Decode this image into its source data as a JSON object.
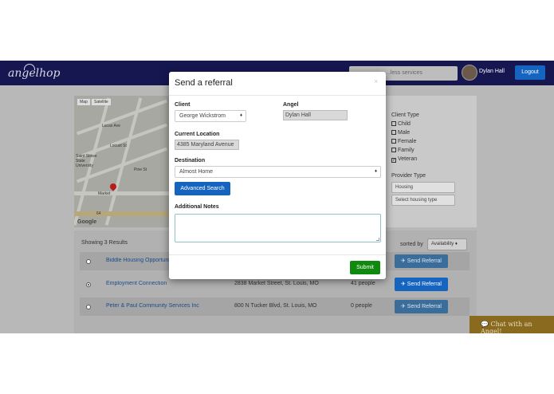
{
  "navbar": {
    "logo": "angelhop",
    "search_placeholder": "...less services",
    "username": "Dylan Hall",
    "logout_label": "Logout"
  },
  "map": {
    "tabs": [
      "Map",
      "Satellite"
    ],
    "labels": [
      "Lucas Ave",
      "Locust St",
      "Pine St",
      "Saint Stowe State University",
      "Market",
      "64"
    ],
    "google": "Google"
  },
  "filters": {
    "client_type_label": "Client Type",
    "client_types": [
      {
        "label": "Child",
        "checked": false
      },
      {
        "label": "Male",
        "checked": false
      },
      {
        "label": "Female",
        "checked": false
      },
      {
        "label": "Family",
        "checked": false
      },
      {
        "label": "Veteran",
        "checked": true
      }
    ],
    "provider_type_label": "Provider Type",
    "provider_type_value": "Housing",
    "housing_type_value": "Select housing type"
  },
  "results": {
    "showing": "Showing 3 Results",
    "sorted_by": "sorted by",
    "sort_value": "Availability",
    "rows": [
      {
        "name": "Biddle Housing Opportunities",
        "address": "",
        "people": "",
        "selected": false,
        "action": "Send Referral"
      },
      {
        "name": "Employment Connection",
        "address": "2838 Market Street, St. Louis, MO",
        "people": "41 people",
        "selected": true,
        "action": "Send Referral"
      },
      {
        "name": "Peter & Paul Community Services Inc",
        "address": "800 N Tucker Blvd, St. Louis, MO",
        "people": "0 people",
        "selected": false,
        "action": "Send Referral"
      }
    ]
  },
  "chat": {
    "label": "Chat with an Angel!"
  },
  "modal": {
    "title": "Send a referral",
    "close": "×",
    "client_label": "Client",
    "client_value": "George Wickstrom",
    "angel_label": "Angel",
    "angel_value": "Dylan Hall",
    "location_label": "Current Location",
    "location_value": "4385 Maryland Avenue",
    "destination_label": "Destination",
    "destination_value": "Almost Home",
    "advanced_search": "Advanced Search",
    "notes_label": "Additional Notes",
    "notes_value": "",
    "submit": "Submit"
  },
  "colors": {
    "navbar": "#161650",
    "primary_button": "#1565c0",
    "submit_button": "#0f8a0f",
    "chat": "#8a6a1e"
  }
}
